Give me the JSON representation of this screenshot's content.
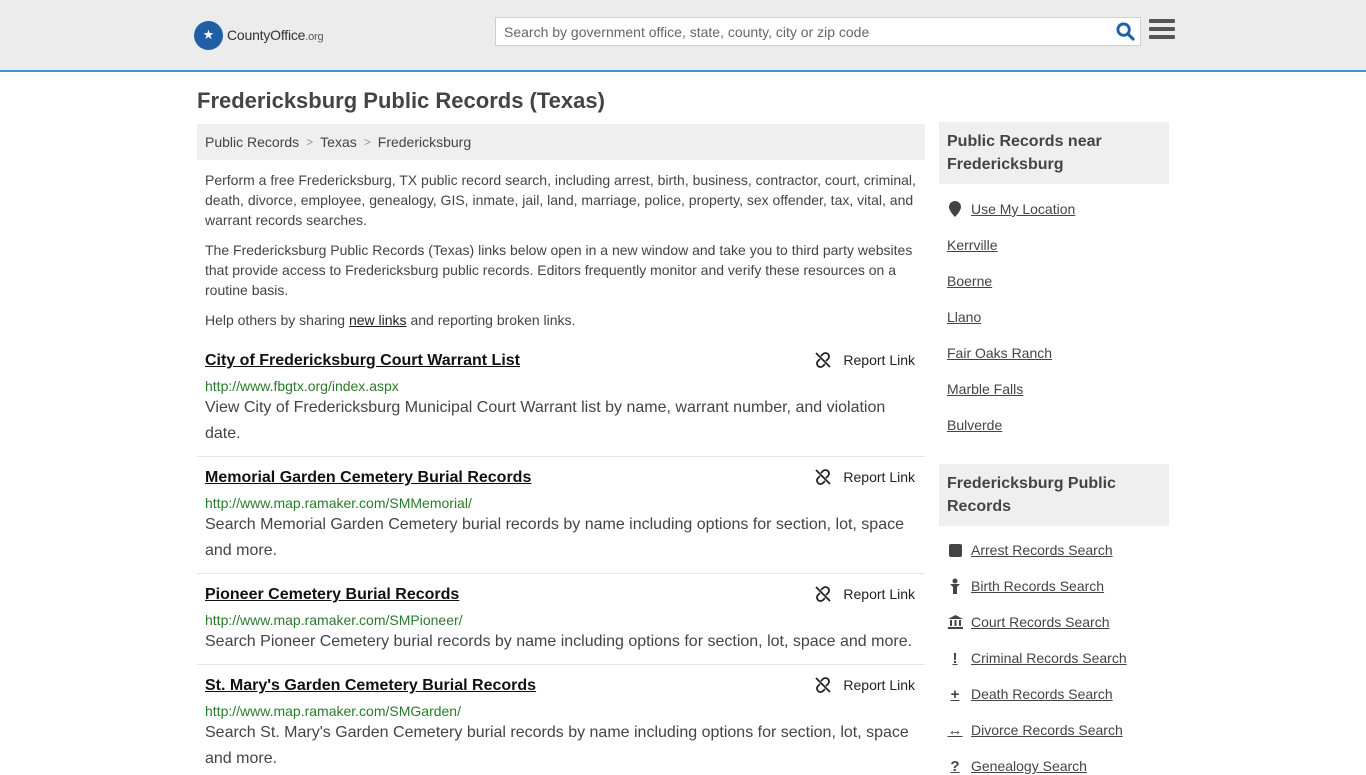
{
  "header": {
    "logo_text": "CountyOffice",
    "logo_tld": ".org",
    "search_placeholder": "Search by government office, state, county, city or zip code"
  },
  "page_title": "Fredericksburg Public Records (Texas)",
  "breadcrumb": [
    "Public Records",
    "Texas",
    "Fredericksburg"
  ],
  "intro": {
    "p1": "Perform a free Fredericksburg, TX public record search, including arrest, birth, business, contractor, court, criminal, death, divorce, employee, genealogy, GIS, inmate, jail, land, marriage, police, property, sex offender, tax, vital, and warrant records searches.",
    "p2": "The Fredericksburg Public Records (Texas) links below open in a new window and take you to third party websites that provide access to Fredericksburg public records. Editors frequently monitor and verify these resources on a routine basis.",
    "p3_before": "Help others by sharing ",
    "p3_link": "new links",
    "p3_after": " and reporting broken links."
  },
  "report_label": "Report Link",
  "records": [
    {
      "title": "City of Fredericksburg Court Warrant List",
      "url": "http://www.fbgtx.org/index.aspx",
      "desc": "View City of Fredericksburg Municipal Court Warrant list by name, warrant number, and violation date."
    },
    {
      "title": "Memorial Garden Cemetery Burial Records",
      "url": "http://www.map.ramaker.com/SMMemorial/",
      "desc": "Search Memorial Garden Cemetery burial records by name including options for section, lot, space and more."
    },
    {
      "title": "Pioneer Cemetery Burial Records",
      "url": "http://www.map.ramaker.com/SMPioneer/",
      "desc": "Search Pioneer Cemetery burial records by name including options for section, lot, space and more."
    },
    {
      "title": "St. Mary's Garden Cemetery Burial Records",
      "url": "http://www.map.ramaker.com/SMGarden/",
      "desc": "Search St. Mary's Garden Cemetery burial records by name including options for section, lot, space and more."
    }
  ],
  "sidebar": {
    "near_title": "Public Records near Fredericksburg",
    "use_location": "Use My Location",
    "near_links": [
      "Kerrville",
      "Boerne",
      "Llano",
      "Fair Oaks Ranch",
      "Marble Falls",
      "Bulverde"
    ],
    "records_title": "Fredericksburg Public Records",
    "record_links": [
      {
        "label": "Arrest Records Search",
        "icon": "square-icon"
      },
      {
        "label": "Birth Records Search",
        "icon": "baby-icon"
      },
      {
        "label": "Court Records Search",
        "icon": "courthouse-icon"
      },
      {
        "label": "Criminal Records Search",
        "icon": "exclamation-icon"
      },
      {
        "label": "Death Records Search",
        "icon": "cross-icon"
      },
      {
        "label": "Divorce Records Search",
        "icon": "arrows-horizontal-icon"
      },
      {
        "label": "Genealogy Search",
        "icon": "question-icon"
      }
    ]
  }
}
